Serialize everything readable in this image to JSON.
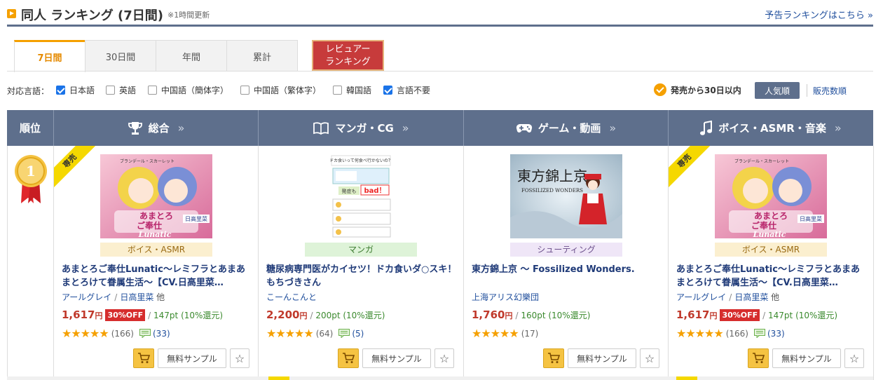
{
  "header": {
    "title": "同人 ランキング (7日間)",
    "note": "※1時間更新",
    "link": "予告ランキングはこちら »"
  },
  "tabs": [
    {
      "label": "7日間",
      "active": true
    },
    {
      "label": "30日間",
      "active": false
    },
    {
      "label": "年間",
      "active": false
    },
    {
      "label": "累計",
      "active": false
    }
  ],
  "review_tab": {
    "line1": "レビュアー",
    "line2": "ランキング"
  },
  "filters": {
    "label": "対応言語：",
    "languages": [
      {
        "label": "日本語",
        "checked": true
      },
      {
        "label": "英語",
        "checked": false
      },
      {
        "label": "中国語（簡体字）",
        "checked": false
      },
      {
        "label": "中国語（繁体字）",
        "checked": false
      },
      {
        "label": "韓国語",
        "checked": false
      },
      {
        "label": "言語不要",
        "checked": true
      }
    ],
    "recent": "発売から30日以内",
    "sort_popular": "人気順",
    "sort_sales": "販売数順"
  },
  "table_header": {
    "rank": "順位",
    "categories": [
      {
        "label": "総合",
        "icon": "trophy-icon"
      },
      {
        "label": "マンガ・CG",
        "icon": "book-icon"
      },
      {
        "label": "ゲーム・動画",
        "icon": "gamepad-icon"
      },
      {
        "label": "ボイス・ASMR・音楽",
        "icon": "music-note-icon"
      }
    ],
    "chevron": "»"
  },
  "rank": {
    "number": "1"
  },
  "products": [
    {
      "exclusive": "専売",
      "genre": "ボイス・ASMR",
      "title": "あまとろご奉仕Lunatic～レミフラとあまあまとろけて眷属生活～【CV.日高里菜…",
      "maker": "アールグレイ",
      "cv": "日高里菜",
      "cv_extra": "他",
      "price": "1,617",
      "yen": "円",
      "discount": "30%OFF",
      "points": "147pt (10%還元)",
      "stars": "★★★★★",
      "reviews": "(166)",
      "comments": "(33)",
      "sample": "無料サンプル",
      "thumb_text_1": "あまとろ",
      "thumb_text_2": "ご奉仕",
      "thumb_text_3": "Lunatic",
      "thumb_text_4": "日高里菜",
      "thumb_text_5": "ブランデール・スカーレット"
    },
    {
      "exclusive": "",
      "genre": "マンガ",
      "title": "糖尿病専門医がカイセツ！ドカ食いダ○スキ！もちづきさん",
      "maker": "こーんこんと",
      "cv": "",
      "cv_extra": "",
      "price": "2,200",
      "yen": "円",
      "discount": "",
      "points": "200pt (10%還元)",
      "stars": "★★★★★",
      "reviews": "(64)",
      "comments": "(5)",
      "sample": "無料サンプル",
      "thumb_text_1": "ドカ食いって何食べ行かないの？",
      "thumb_text_2": "bad！",
      "thumb_text_3": "発症も",
      "thumb_text_4": "",
      "thumb_text_5": ""
    },
    {
      "exclusive": "",
      "genre": "シューティング",
      "title": "東方錦上京 ～ Fossilized Wonders.",
      "maker": "上海アリス幻樂団",
      "cv": "",
      "cv_extra": "",
      "price": "1,760",
      "yen": "円",
      "discount": "",
      "points": "160pt (10%還元)",
      "stars": "★★★★★",
      "reviews": "(17)",
      "comments": "",
      "sample": "無料サンプル",
      "thumb_text_1": "東方錦上京",
      "thumb_text_2": "FOSSILIZED WONDERS",
      "thumb_text_3": "",
      "thumb_text_4": "",
      "thumb_text_5": ""
    },
    {
      "exclusive": "専売",
      "genre": "ボイス・ASMR",
      "title": "あまとろご奉仕Lunatic～レミフラとあまあまとろけて眷属生活～【CV.日高里菜…",
      "maker": "アールグレイ",
      "cv": "日高里菜",
      "cv_extra": "他",
      "price": "1,617",
      "yen": "円",
      "discount": "30%OFF",
      "points": "147pt (10%還元)",
      "stars": "★★★★★",
      "reviews": "(166)",
      "comments": "(33)",
      "sample": "無料サンプル",
      "thumb_text_1": "あまとろ",
      "thumb_text_2": "ご奉仕",
      "thumb_text_3": "Lunatic",
      "thumb_text_4": "日高里菜",
      "thumb_text_5": "ブランデール・スカーレット"
    }
  ],
  "colors": {
    "header_bar": "#5e6f8c",
    "accent": "#f5a000",
    "price": "#c0392b",
    "link": "#1f4e9c"
  }
}
